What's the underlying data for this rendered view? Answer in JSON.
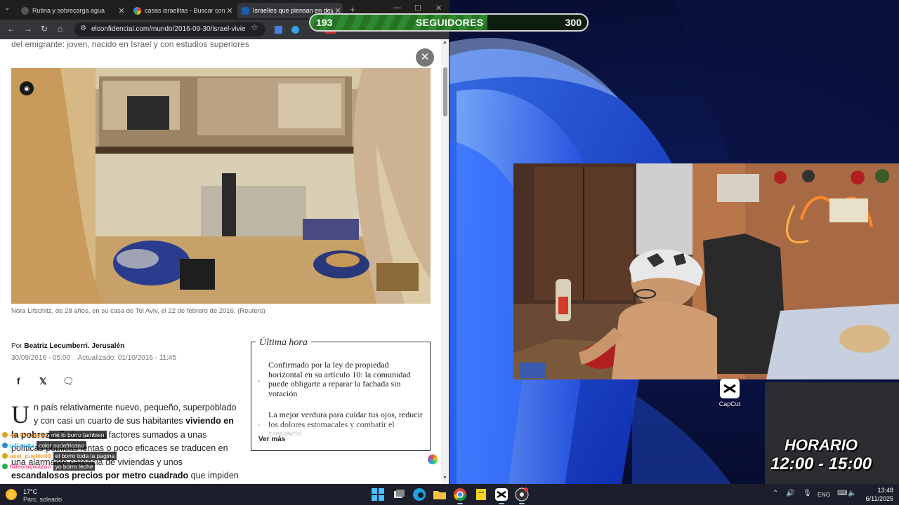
{
  "browser": {
    "tabs": [
      {
        "title": "Rutina y sobrecarga agua",
        "active": false
      },
      {
        "title": "casas israelitas - Buscar con Go",
        "active": false
      },
      {
        "title": "Israelíes que piensan en dejar",
        "active": true
      }
    ],
    "url": "elconfidencial.com/mundo/2016-09-30/israel-vivie...",
    "ext_badge": "NEW"
  },
  "article": {
    "subtitle_fragment": "del emigrante: joven, nacido en Israel y con estudios superiores",
    "photo_caption": "Nora Lifschitz, de 28 años, en su casa de Tel Aviv, el 22 de febrero de 2016. (Reuters)",
    "byline_prefix": "Por",
    "author": "Beatriz Lecumberri. Jerusalén",
    "published": "30/09/2016 - 05:00",
    "updated": "Actualizado: 01/10/2016 - 11:45",
    "dropcap": "U",
    "body_1": "n país relativamente nuevo, pequeño, superpoblado y con casi un cuarto de sus habitantes ",
    "body_bold_1": "viviendo en la pobreza",
    "body_2": ". Todos estos factores sumados a unas políticas públicas lentas o poco eficaces se traducen en una alarmante carencia de viviendas y unos ",
    "body_bold_2": "escandalosos precios por metro cuadrado",
    "body_3": " que impiden a"
  },
  "breaking_news": {
    "heading": "Última hora",
    "items": [
      "Confirmado por la ley de propiedad horizontal en su artículo 10: la comunidad puede obligarte a reparar la fachada sin votación",
      "La mejor verdura para cuidar tus ojos, reducir los dolores estomacales y combatir el cansancio"
    ],
    "more": "Ver más"
  },
  "chat": [
    {
      "user": "sn_hvazquez",
      "msg": "me lo borro tambien",
      "color": "#ff9f2e"
    },
    {
      "user": "p4lomita",
      "msg": "color sudafricano",
      "color": "#3fbfff"
    },
    {
      "user": "axel_pueblo00",
      "msg": "el borro toda la pagina",
      "color": "#ff9f2e"
    },
    {
      "user": "fideomijwazon",
      "msg": "yo borro leche",
      "color": "#ff4d8a"
    }
  ],
  "followers": {
    "current": "193",
    "label": "SEGUIDORES",
    "goal": "300",
    "progress": 0.64
  },
  "desktop": {
    "icon_label": "CapCut"
  },
  "schedule": {
    "title": "HORARIO",
    "hours": "12:00 - 15:00"
  },
  "taskbar": {
    "temperature": "17°C",
    "condition": "Parc. soleado",
    "language": "ENG",
    "time": "13:48",
    "date": "6/11/2025"
  },
  "colors": {
    "accent_green": "#2e8a2e",
    "wallpaper_blue": "#1f4fd8",
    "text_dark": "#222222"
  }
}
